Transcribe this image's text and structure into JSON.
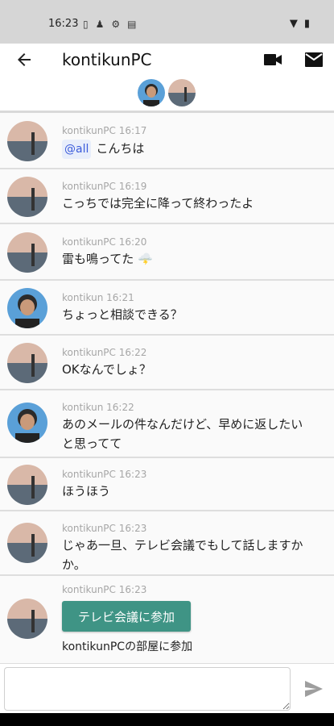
{
  "status_bar": {
    "time": "16:23",
    "left_icons": [
      "sim-icon",
      "person-icon",
      "settings-icon",
      "calendar-icon"
    ],
    "right_icons": [
      "wifi-icon",
      "battery-icon"
    ]
  },
  "app_bar": {
    "title": "kontikunPC",
    "icons": [
      "back-arrow-icon",
      "video-call-icon",
      "mail-icon"
    ],
    "members": [
      "kontikun",
      "kontikunPC"
    ]
  },
  "messages": [
    {
      "author": "kontikunPC",
      "time": "16:17",
      "mention": "@all",
      "text": "こんちは"
    },
    {
      "author": "kontikunPC",
      "time": "16:19",
      "text": "こっちでは完全に降って終わったよ"
    },
    {
      "author": "kontikunPC",
      "time": "16:20",
      "text": "雷も鳴ってた 🌩️"
    },
    {
      "author": "kontikun",
      "time": "16:21",
      "text": "ちょっと相談できる？"
    },
    {
      "author": "kontikunPC",
      "time": "16:22",
      "text": "OKなんでしょ？"
    },
    {
      "author": "kontikun",
      "time": "16:22",
      "text_line1": "あのメールの件なんだけど、早めに返したい",
      "text_line2": "と思ってて"
    },
    {
      "author": "kontikunPC",
      "time": "16:23",
      "text": "ほうほう"
    },
    {
      "author": "kontikunPC",
      "time": "16:23",
      "text_line1": "じゃあ一旦、テレビ会議でもして話しますか",
      "text_line2": "か。"
    },
    {
      "author": "kontikunPC",
      "time": "16:23",
      "button_label": "テレビ会議に参加",
      "caption": "kontikunPCの部屋に参加"
    }
  ],
  "composer": {
    "placeholder": "",
    "send_icon": "send-icon"
  },
  "colors": {
    "accent": "#3f9485",
    "status_bar": "#d6d6d6",
    "mention_bg": "#e8eefb"
  }
}
